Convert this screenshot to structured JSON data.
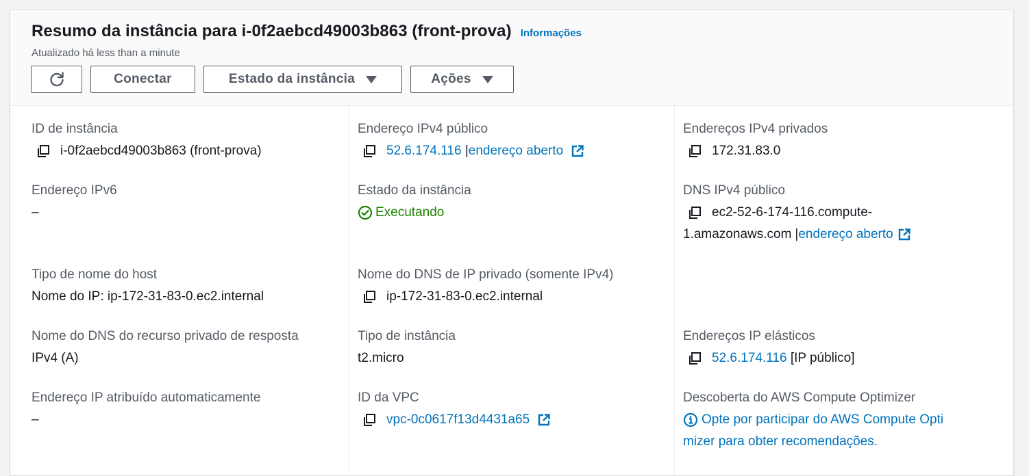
{
  "header": {
    "title": "Resumo da instância para i-0f2aebcd49003b863 (front-prova)",
    "info_link": "Informações",
    "updated": "Atualizado há less than a minute"
  },
  "buttons": {
    "refresh_icon": "refresh-icon",
    "connect": "Conectar",
    "instance_state": "Estado da instância",
    "actions": "Ações"
  },
  "fields": {
    "instance_id": {
      "label": "ID de instância",
      "value": "i-0f2aebcd49003b863 (front-prova)"
    },
    "ipv6": {
      "label": "Endereço IPv6",
      "value": "–"
    },
    "hostname_type": {
      "label": "Tipo de nome do host",
      "value": "Nome do IP: ip-172-31-83-0.ec2.internal"
    },
    "private_dns_answer": {
      "label": "Nome do DNS do recurso privado de resposta",
      "value": "IPv4 (A)"
    },
    "auto_ip": {
      "label": "Endereço IP atribuído automaticamente",
      "value": "–"
    },
    "public_ipv4": {
      "label": "Endereço IPv4 público",
      "value": "52.6.174.116",
      "separator": "|",
      "open_link": "endereço aberto"
    },
    "instance_state": {
      "label": "Estado da instância",
      "value": "Executando"
    },
    "private_ip_dns": {
      "label": "Nome do DNS de IP privado (somente IPv4)",
      "value": "ip-172-31-83-0.ec2.internal"
    },
    "instance_type": {
      "label": "Tipo de instância",
      "value": "t2.micro"
    },
    "vpc_id": {
      "label": "ID da VPC",
      "value": "vpc-0c0617f13d4431a65"
    },
    "private_ipv4": {
      "label": "Endereços IPv4 privados",
      "value": "172.31.83.0"
    },
    "public_dns": {
      "label": "DNS IPv4 público",
      "value_line1": "ec2-52-6-174-116.compute-",
      "value_line2": "1.amazonaws.com",
      "separator": "|",
      "open_link": "endereço aberto"
    },
    "elastic_ips": {
      "label": "Endereços IP elásticos",
      "value": "52.6.174.116",
      "suffix": "[IP público]"
    },
    "compute_optimizer": {
      "label": "Descoberta do AWS Compute Optimizer",
      "line1": "Opte por participar do AWS Compute Opti",
      "line2": "mizer para obter recomendações."
    }
  },
  "colors": {
    "link": "#0073bb",
    "success": "#1d8102",
    "label": "#545b64",
    "text": "#16191f"
  }
}
